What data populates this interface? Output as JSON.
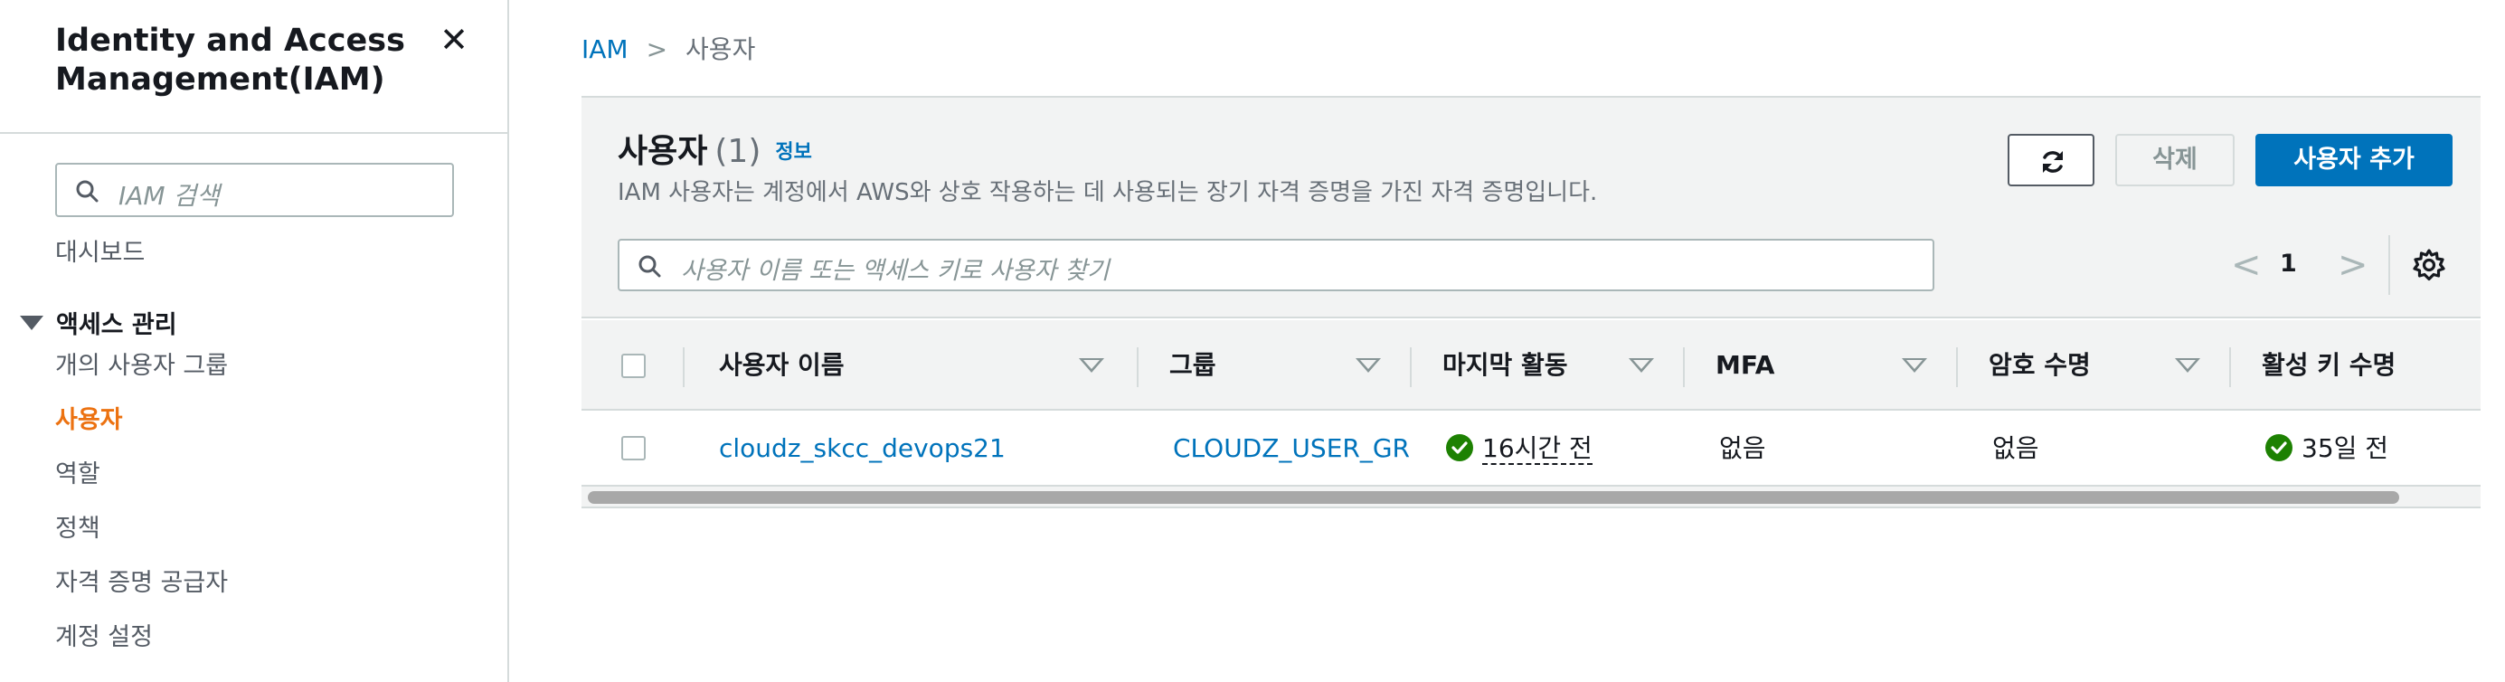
{
  "sidebar": {
    "title": "Identity and Access Management(IAM)",
    "close_icon": "close-icon",
    "search": {
      "placeholder": "IAM 검색"
    },
    "dashboard": "대시보드",
    "section_access": "액세스 관리",
    "items": [
      {
        "label": "개의 사용자 그룹",
        "active": false
      },
      {
        "label": "사용자",
        "active": true
      },
      {
        "label": "역할",
        "active": false
      },
      {
        "label": "정책",
        "active": false
      },
      {
        "label": "자격 증명 공급자",
        "active": false
      },
      {
        "label": "계정 설정",
        "active": false
      }
    ]
  },
  "breadcrumb": {
    "root": "IAM",
    "separator": ">",
    "current": "사용자"
  },
  "panel": {
    "title": "사용자",
    "count": "(1)",
    "info": "정보",
    "description": "IAM 사용자는 계정에서 AWS와 상호 작용하는 데 사용되는 장기 자격 증명을 가진 자격 증명입니다.",
    "buttons": {
      "refresh_icon": "refresh-icon",
      "delete": "삭제",
      "add_user": "사용자 추가"
    },
    "search": {
      "placeholder": "사용자 이름 또는 액세스 키로 사용자 찾기"
    },
    "pagination": {
      "prev": "<",
      "page": "1",
      "next": ">"
    },
    "settings_icon": "gear-icon"
  },
  "table": {
    "columns": [
      "사용자 이름",
      "그룹",
      "마지막 활동",
      "MFA",
      "암호 수명",
      "활성 키 수명"
    ],
    "rows": [
      {
        "user_name": "cloudz_skcc_devops21",
        "group": "CLOUDZ_USER_GROUP",
        "last_activity": "16시간 전",
        "mfa": "없음",
        "password_age": "없음",
        "active_key_age": "35일 전"
      }
    ]
  },
  "colors": {
    "accent_orange": "#ec7211",
    "link_blue": "#0073bb",
    "primary_button": "#0073bb",
    "success_green": "#1d8102"
  }
}
